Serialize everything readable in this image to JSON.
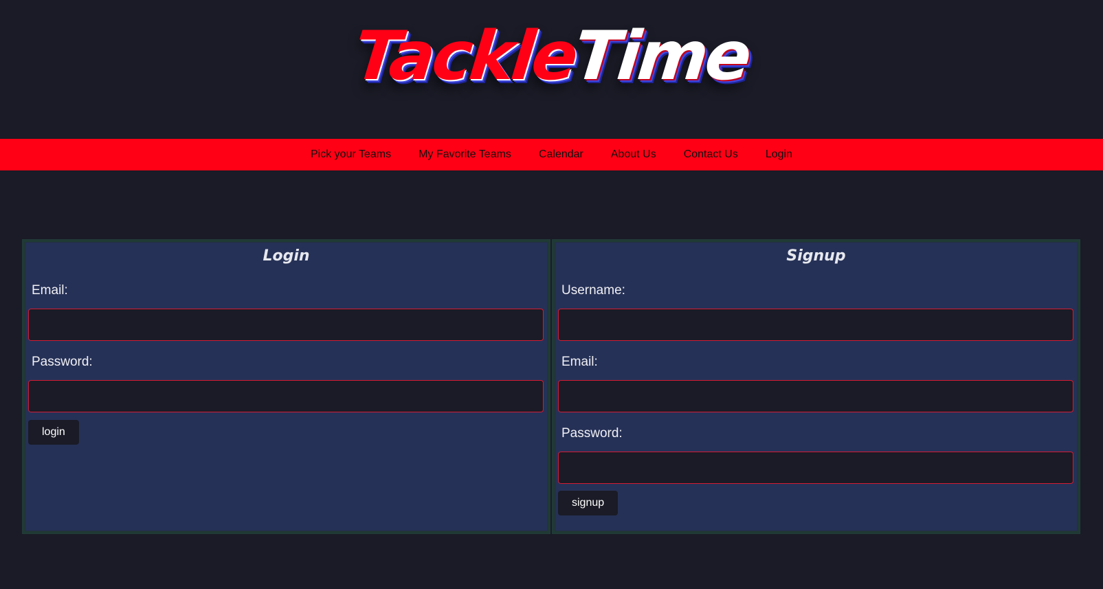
{
  "logo": {
    "part1": "Tackle",
    "part2": "Time"
  },
  "nav": {
    "items": [
      {
        "label": "Pick your Teams"
      },
      {
        "label": "My Favorite Teams"
      },
      {
        "label": "Calendar"
      },
      {
        "label": "About Us"
      },
      {
        "label": "Contact Us"
      },
      {
        "label": "Login"
      }
    ]
  },
  "login": {
    "title": "Login",
    "email_label": "Email:",
    "email_value": "",
    "password_label": "Password:",
    "password_value": "",
    "button_label": "login"
  },
  "signup": {
    "title": "Signup",
    "username_label": "Username:",
    "username_value": "",
    "email_label": "Email:",
    "email_value": "",
    "password_label": "Password:",
    "password_value": "",
    "button_label": "signup"
  },
  "colors": {
    "background": "#1a1b26",
    "accent": "#ff0015",
    "panel": "#263157",
    "input_border": "#d61a32"
  }
}
